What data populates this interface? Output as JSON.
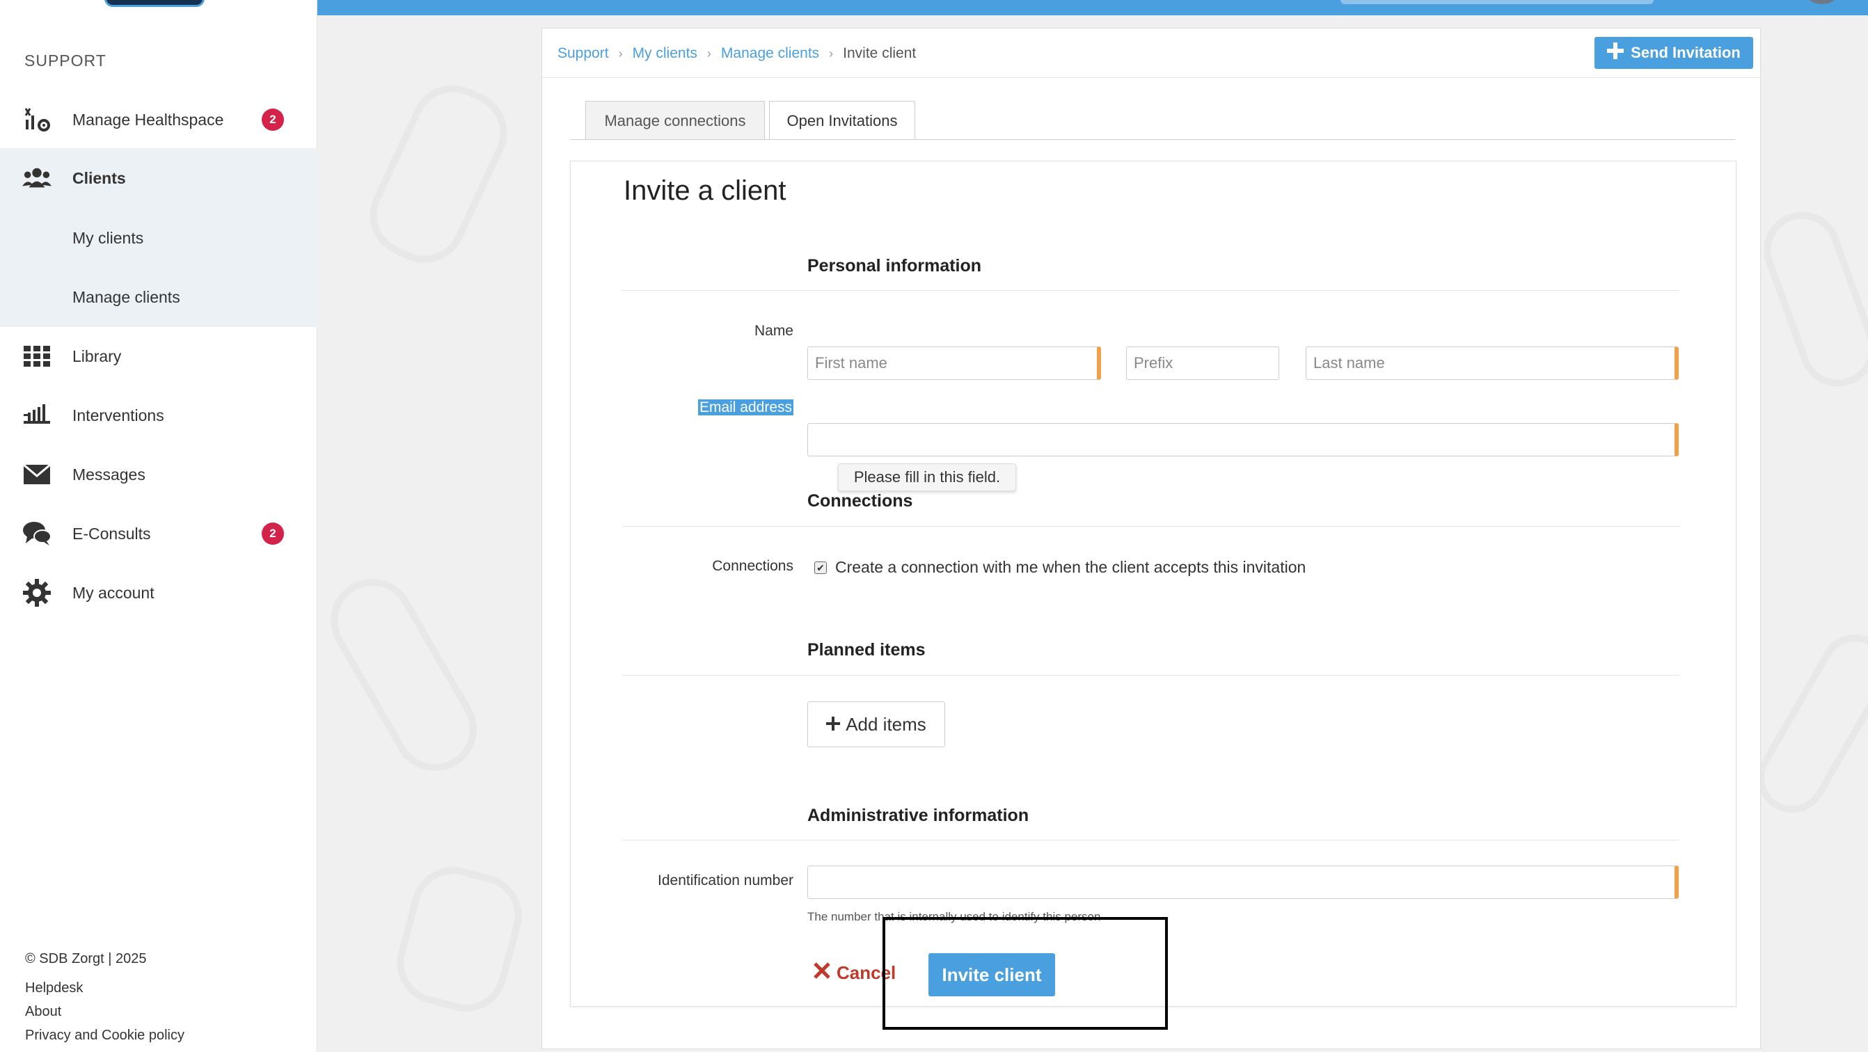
{
  "sidebar": {
    "section_title": "SUPPORT",
    "items": [
      {
        "label": "Manage Healthspace",
        "icon": "healthspace-icon",
        "badge": "2"
      },
      {
        "label": "Clients",
        "icon": "clients-icon"
      },
      {
        "label": "My clients"
      },
      {
        "label": "Manage clients"
      },
      {
        "label": "Library",
        "icon": "grid-icon"
      },
      {
        "label": "Interventions",
        "icon": "interventions-icon"
      },
      {
        "label": "Messages",
        "icon": "envelope-icon"
      },
      {
        "label": "E-Consults",
        "icon": "chat-icon",
        "badge": "2"
      },
      {
        "label": "My account",
        "icon": "gear-icon"
      }
    ],
    "footer": {
      "copyright": "© SDB Zorgt | 2025",
      "helpdesk": "Helpdesk",
      "about": "About",
      "privacy": "Privacy and Cookie policy"
    }
  },
  "breadcrumb": {
    "items": [
      "Support",
      "My clients",
      "Manage clients"
    ],
    "current": "Invite client"
  },
  "header": {
    "send_invitation": "Send Invitation"
  },
  "tabs": [
    {
      "label": "Manage connections",
      "active": false
    },
    {
      "label": "Open Invitations",
      "active": true
    }
  ],
  "form": {
    "title": "Invite a client",
    "personal": {
      "heading": "Personal information",
      "name_label": "Name",
      "first_name_placeholder": "First name",
      "prefix_placeholder": "Prefix",
      "last_name_placeholder": "Last name",
      "email_label": "Email address",
      "tooltip": "Please fill in this field."
    },
    "connections": {
      "heading": "Connections",
      "label": "Connections",
      "checkbox_text": "Create a connection with me when the client accepts this invitation",
      "checked": true
    },
    "planned": {
      "heading": "Planned items",
      "add_label": "Add items"
    },
    "admin": {
      "heading": "Administrative information",
      "id_label": "Identification number",
      "hint": "The number that is internally used to identify this person"
    },
    "actions": {
      "cancel": "Cancel",
      "submit": "Invite client"
    }
  },
  "colors": {
    "accent": "#4a9fde",
    "badge": "#d3234a",
    "required": "#f0a04b",
    "cancel": "#c0392b"
  }
}
